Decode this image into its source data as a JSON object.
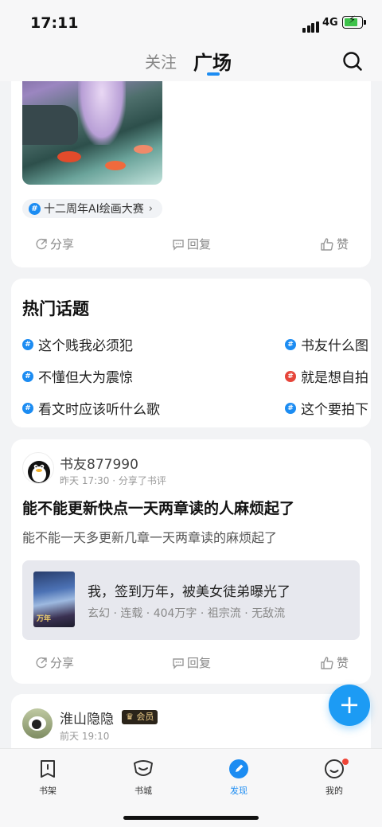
{
  "status": {
    "time": "17:11",
    "network": "4G"
  },
  "header": {
    "tab_follow": "关注",
    "tab_square": "广场"
  },
  "card1": {
    "topic_chip": "十二周年AI绘画大赛",
    "actions": {
      "share": "分享",
      "reply": "回复",
      "like": "赞"
    }
  },
  "hot_topics": {
    "title": "热门话题",
    "items": [
      {
        "label": "这个贱我必须犯"
      },
      {
        "label": "书友什么图"
      },
      {
        "label": "不懂但大为震惊"
      },
      {
        "label": "就是想自拍"
      },
      {
        "label": "看文时应该听什么歌"
      },
      {
        "label": "这个要拍下"
      }
    ]
  },
  "post": {
    "user": "书友877990",
    "meta": "昨天 17:30 · 分享了书评",
    "title": "能不能更新快点一天两章读的人麻烦起了",
    "text": "能不能一天多更新几章一天两章读的麻烦起了",
    "book": {
      "title": "我，签到万年，被美女徒弟曝光了",
      "meta": "玄幻 · 连载 · 404万字 · 祖宗流 · 无敌流"
    },
    "actions": {
      "share": "分享",
      "reply": "回复",
      "like": "赞"
    }
  },
  "post2": {
    "user": "淮山隐隐",
    "badge": "会员",
    "meta": "前天 19:10"
  },
  "fab": "+",
  "tabs": [
    {
      "label": "书架"
    },
    {
      "label": "书城"
    },
    {
      "label": "发现"
    },
    {
      "label": "我的"
    }
  ],
  "colors": {
    "accent": "#1c8cf2",
    "fab": "#1c9bf4",
    "badge_bg": "#2b241a"
  }
}
